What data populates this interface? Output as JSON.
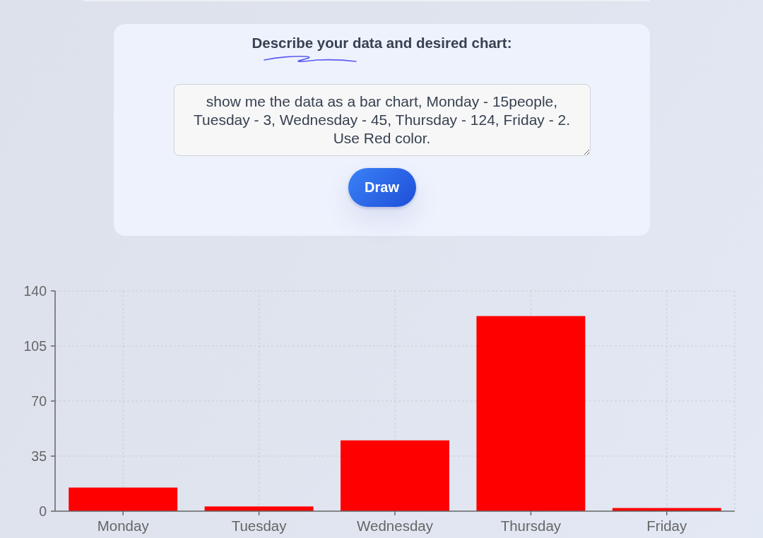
{
  "prompt_card": {
    "title": "Describe your data and desired chart:",
    "prompt_input": {
      "value": "show me the data as a bar chart, Monday - 15people, Tuesday - 3, Wednesday - 45, Thursday - 124, Friday - 2. Use Red color."
    },
    "draw_button": "Draw"
  },
  "chart": {
    "chart_data": {
      "type": "bar",
      "categories": [
        "Monday",
        "Tuesday",
        "Wednesday",
        "Thursday",
        "Friday"
      ],
      "series": [
        {
          "color": "#ff0000",
          "values": [
            15,
            3,
            45,
            124,
            2
          ]
        }
      ],
      "ylim": [
        0,
        140
      ],
      "yticks": [
        0,
        35,
        70,
        105,
        140
      ],
      "grid": true
    }
  }
}
